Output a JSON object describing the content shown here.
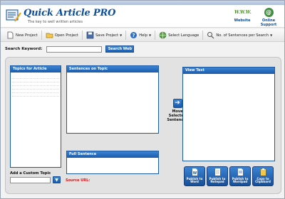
{
  "app": {
    "title": "Quick Article PRO",
    "tagline": "The key to well written articles"
  },
  "header_links": [
    {
      "label": "Website",
      "icon": "www-icon",
      "icon_text": "W.W.W."
    },
    {
      "label": "Online Support",
      "icon": "at-sign-icon",
      "icon_text": "@"
    }
  ],
  "toolbar": {
    "new_project": "New Project",
    "open_project": "Open Project",
    "save_project": "Save Project",
    "help": "Help",
    "select_language": "Select Language",
    "sentences_per_search": "No. of Sentences per Search"
  },
  "search": {
    "label": "Search Keyword:",
    "value": "",
    "button": "Search Web"
  },
  "panels": {
    "topics": "Topics for Article",
    "sentences": "Sentences on Topic",
    "full_sentence": "Full Sentence",
    "view_text": "View Text"
  },
  "move_button": {
    "label": "Move Selected Sentences",
    "icon": "arrow-right-icon"
  },
  "custom_topic": {
    "label": "Add a Custom Topic",
    "value": ""
  },
  "source_url": {
    "label": "Source URL:",
    "color": "#d21a1a"
  },
  "publish_buttons": [
    {
      "label": "Publish to Word"
    },
    {
      "label": "Publish to Notepad"
    },
    {
      "label": "Publish to Wordpad"
    },
    {
      "label": "Copy to Clipboard"
    }
  ],
  "colors": {
    "accent": "#1d5aa6",
    "brand": "#0b4fa0"
  }
}
